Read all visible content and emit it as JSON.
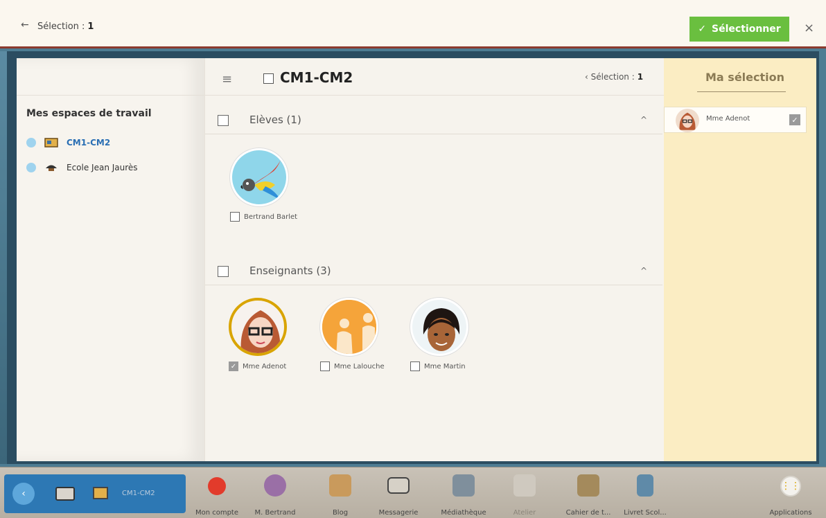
{
  "header": {
    "back_arrow": "←",
    "title_label": "Sélection :",
    "title_count": "1",
    "select_button": "Sélectionner",
    "select_check": "✓",
    "close": "×"
  },
  "workspaces": {
    "title": "Mes espaces de travail",
    "items": [
      {
        "label": "CM1-CM2",
        "active": true
      },
      {
        "label": "Ecole Jean Jaurès",
        "active": false
      }
    ]
  },
  "main": {
    "menu_icon": "≡",
    "title": "CM1-CM2",
    "selection_label": "‹ Sélection :",
    "selection_count": "1",
    "sections": [
      {
        "label": "Elèves (1)",
        "chevron": "^",
        "people": [
          {
            "name": "Bertrand Barlet",
            "checked": false
          }
        ]
      },
      {
        "label": "Enseignants (3)",
        "chevron": "^",
        "people": [
          {
            "name": "Mme Adenot",
            "checked": true
          },
          {
            "name": "Mme Lalouche",
            "checked": false
          },
          {
            "name": "Mme Martin",
            "checked": false
          }
        ]
      }
    ]
  },
  "selection_panel": {
    "title": "Ma sélection",
    "items": [
      {
        "name": "Mme Adenot",
        "checked": true
      }
    ]
  },
  "taskbar": {
    "current_class": "CM1-CM2",
    "items": [
      {
        "label": "Mon compte",
        "icon": "account-icon",
        "disabled": false
      },
      {
        "label": "M. Bertrand",
        "icon": "user-profile-icon",
        "disabled": false
      },
      {
        "label": "Blog",
        "icon": "blog-icon",
        "disabled": false
      },
      {
        "label": "Messagerie",
        "icon": "mail-icon",
        "disabled": false
      },
      {
        "label": "Médiathèque",
        "icon": "media-library-icon",
        "disabled": false
      },
      {
        "label": "Atelier",
        "icon": "workshop-icon",
        "disabled": true
      },
      {
        "label": "Cahier de t...",
        "icon": "notebook-icon",
        "disabled": false
      },
      {
        "label": "Livret Scol...",
        "icon": "school-report-icon",
        "disabled": false
      },
      {
        "label": "Applications",
        "icon": "apps-grid-icon",
        "disabled": false
      }
    ]
  },
  "colors": {
    "accent_green": "#6abf3f",
    "active_blue": "#2a6fb4",
    "selection_panel_bg": "#fbedc3",
    "selected_avatar_ring": "#d9a400"
  }
}
